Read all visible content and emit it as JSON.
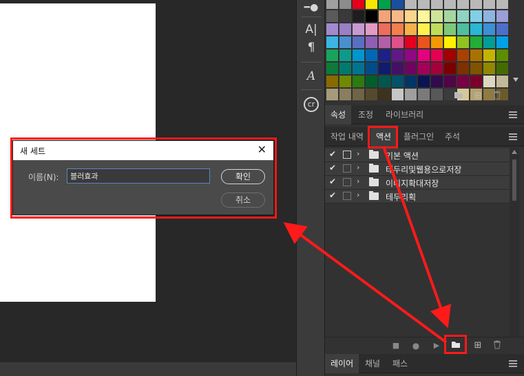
{
  "dialog": {
    "title": "새 세트",
    "close_glyph": "✕",
    "name_label": "이름(N):",
    "name_value": "블러효과",
    "ok_label": "확인",
    "cancel_label": "취소"
  },
  "tools": {
    "character_glyph": "A|",
    "paragraph_glyph": "¶",
    "glyphs_glyph": "A",
    "cc_glyph": "cr"
  },
  "properties_tabs": [
    "속성",
    "조정",
    "라이브러리"
  ],
  "actions_tabs": [
    "작업 내역",
    "액션",
    "플러그인",
    "주석"
  ],
  "actions_active_tab": "액션",
  "actions": [
    {
      "label": "기본 액션",
      "checked": true,
      "dialog": true
    },
    {
      "label": "테두리및웹용으로저장",
      "checked": true,
      "dialog": false
    },
    {
      "label": "이미지확대저장",
      "checked": true,
      "dialog": false
    },
    {
      "label": "테두리획",
      "checked": true,
      "dialog": false
    }
  ],
  "layers_tabs": [
    "레이어",
    "채널",
    "패스"
  ],
  "footer_icons": {
    "stop": "■",
    "record": "●",
    "play": "▶",
    "new_set": "folder-icon",
    "new_action": "⊞",
    "delete": "🗑"
  },
  "swatches": [
    "#a0a0a0",
    "#8c8c8c",
    "#e6001c",
    "#f7e600",
    "#00a14b",
    "#1a4fa0",
    "#b9b9b9",
    "#b9b9b9",
    "#b9b9b9",
    "#b9b9b9",
    "#b9b9b9",
    "#b9b9b9",
    "#b9b9b9",
    "#b9b9b9",
    "#5a5a5a",
    "#3a3a3a",
    "#1e1e1e",
    "#000000",
    "#f4a27a",
    "#f7b88a",
    "#fbd58c",
    "#fff59a",
    "#cde59a",
    "#a7d7a0",
    "#8fd3c2",
    "#84cde6",
    "#8fb3e0",
    "#9a9fd6",
    "#a28ad0",
    "#9b7fc4",
    "#c69ad0",
    "#e39ac4",
    "#ef6b5b",
    "#f47f4a",
    "#f8b04a",
    "#fff04e",
    "#bedc5a",
    "#7fc87a",
    "#4dbfa0",
    "#28b7d6",
    "#3d8fd6",
    "#4d6fc9",
    "#3ab5e6",
    "#4a8fcf",
    "#5a6fc0",
    "#8e5fb5",
    "#b35fa8",
    "#e0508a",
    "#e4001f",
    "#e9541b",
    "#f39800",
    "#fff100",
    "#8fc31f",
    "#22ac38",
    "#009e96",
    "#00a0e9",
    "#1aa35a",
    "#0d9a8a",
    "#0096cf",
    "#0068b7",
    "#1d2088",
    "#601986",
    "#920783",
    "#e4007f",
    "#e5004f",
    "#a40000",
    "#a84200",
    "#a87200",
    "#c4b400",
    "#5b8e00",
    "#0e7a3a",
    "#007a6e",
    "#00748f",
    "#004c8a",
    "#101c6e",
    "#441066",
    "#6e0462",
    "#a30059",
    "#a4003a",
    "#7a0000",
    "#7e3100",
    "#7f5400",
    "#918700",
    "#436b00",
    "#8a6a00",
    "#6e8a00",
    "#2e7a10",
    "#005e2a",
    "#00574f",
    "#005369",
    "#003568",
    "#0b1452",
    "#310b4c",
    "#510447",
    "#790044",
    "#7a002b",
    "#ddd7c0",
    "#c2b99a",
    "#a59a7a",
    "#8a7e5e",
    "#6f6445",
    "#56492e",
    "#3d331c",
    "#c7c7c7",
    "#9f9f9f",
    "#7a7a7a",
    "#585858",
    "#3c3c3c",
    "#d7c89a",
    "#b7a16a",
    "#8e7a44",
    "#6b5a2a"
  ]
}
